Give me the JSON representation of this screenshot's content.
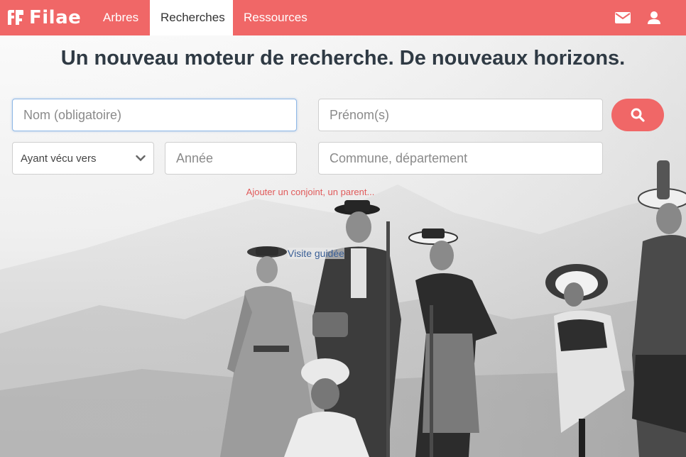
{
  "brand": {
    "name": "Filae",
    "color": "#f06767"
  },
  "nav": {
    "tabs": [
      {
        "label": "Arbres",
        "active": false
      },
      {
        "label": "Recherches",
        "active": true
      },
      {
        "label": "Ressources",
        "active": false
      }
    ],
    "icons": [
      "mail-icon",
      "user-icon"
    ]
  },
  "hero": {
    "title": "Un nouveau moteur de recherche. De nouveaux horizons."
  },
  "search": {
    "name_placeholder": "Nom (obligatoire)",
    "name_value": "",
    "firstname_placeholder": "Prénom(s)",
    "period_select": "Ayant vécu vers",
    "year_placeholder": "Année",
    "place_placeholder": "Commune, département",
    "submit_icon": "search-icon"
  },
  "links": {
    "add_relative": "Ajouter un conjoint, un parent...",
    "guided_tour": "Visite guidée"
  }
}
